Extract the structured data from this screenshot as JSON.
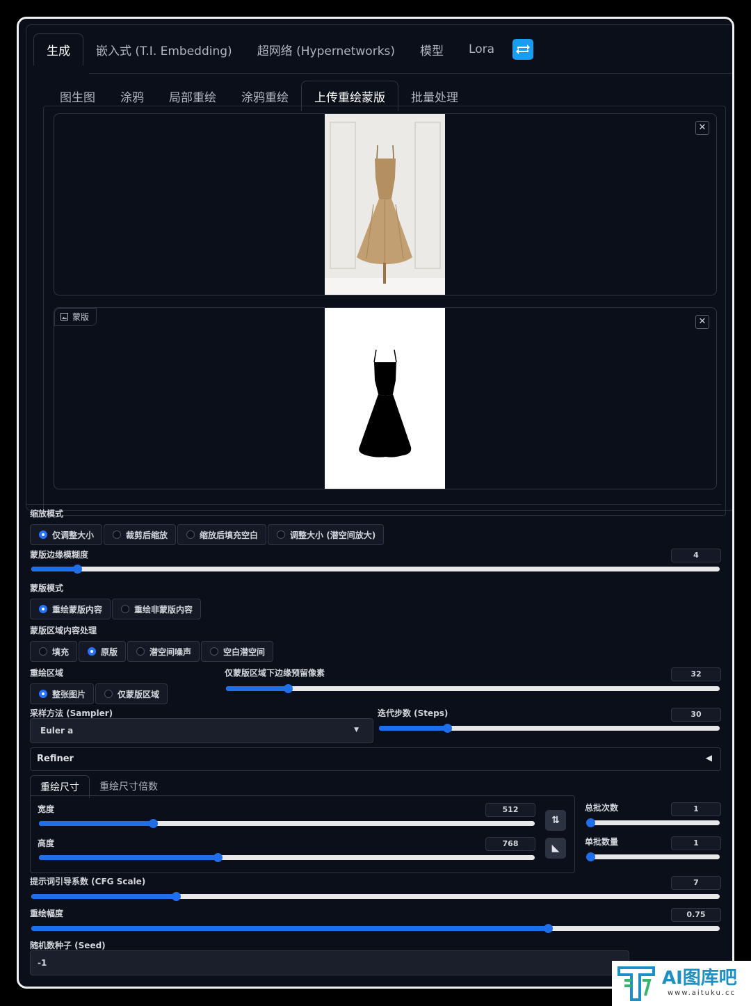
{
  "top_tabs": [
    "生成",
    "嵌入式 (T.I. Embedding)",
    "超网络 (Hypernetworks)",
    "模型",
    "Lora"
  ],
  "sub_tabs": [
    "图生图",
    "涂鸦",
    "局部重绘",
    "涂鸦重绘",
    "上传重绘蒙版",
    "批量处理"
  ],
  "image_panel": {
    "close_glyph": "✕",
    "mask_label": "蒙版"
  },
  "resize_mode": {
    "label": "缩放模式",
    "options": [
      "仅调整大小",
      "裁剪后缩放",
      "缩放后填充空白",
      "调整大小 (潜空间放大)"
    ],
    "selected": 0
  },
  "mask_blur": {
    "label": "蒙版边缘模糊度",
    "value": "4",
    "fraction": 0.067
  },
  "mask_mode": {
    "label": "蒙版模式",
    "options": [
      "重绘蒙版内容",
      "重绘非蒙版内容"
    ],
    "selected": 0
  },
  "masked_content": {
    "label": "蒙版区域内容处理",
    "options": [
      "填充",
      "原版",
      "潜空间噪声",
      "空白潜空间"
    ],
    "selected": 1
  },
  "inpaint_area": {
    "label": "重绘区域",
    "options": [
      "整张图片",
      "仅蒙版区域"
    ],
    "selected": 0
  },
  "padding": {
    "label": "仅蒙版区域下边缘预留像素",
    "value": "32",
    "fraction": 0.125
  },
  "sampler": {
    "label": "采样方法 (Sampler)",
    "value": "Euler a",
    "arrow": "▼"
  },
  "steps": {
    "label": "迭代步数 (Steps)",
    "value": "30",
    "fraction": 0.2
  },
  "refiner": {
    "label": "Refiner",
    "arrow": "◀"
  },
  "size_tabs": [
    "重绘尺寸",
    "重绘尺寸倍数"
  ],
  "width": {
    "label": "宽度",
    "value": "512",
    "fraction": 0.23
  },
  "height": {
    "label": "高度",
    "value": "768",
    "fraction": 0.36
  },
  "swap_icon": "⇅",
  "ratio_icon": "◣",
  "batch_count": {
    "label": "总批次数",
    "value": "1",
    "fraction": 0.0
  },
  "batch_size": {
    "label": "单批数量",
    "value": "1",
    "fraction": 0.0
  },
  "cfg": {
    "label": "提示词引导系数 (CFG Scale)",
    "value": "7",
    "fraction": 0.21
  },
  "denoise": {
    "label": "重绘幅度",
    "value": "0.75",
    "fraction": 0.75
  },
  "seed": {
    "label": "随机数种子 (Seed)",
    "value": "-1"
  },
  "watermark": {
    "title": "AI图库吧",
    "url": "www.aituku.cc"
  },
  "colors": {
    "background": "#0b0f19",
    "accent": "#1f6feb",
    "refresh": "#1a9cf0",
    "watermark": "#1d8fc4"
  }
}
